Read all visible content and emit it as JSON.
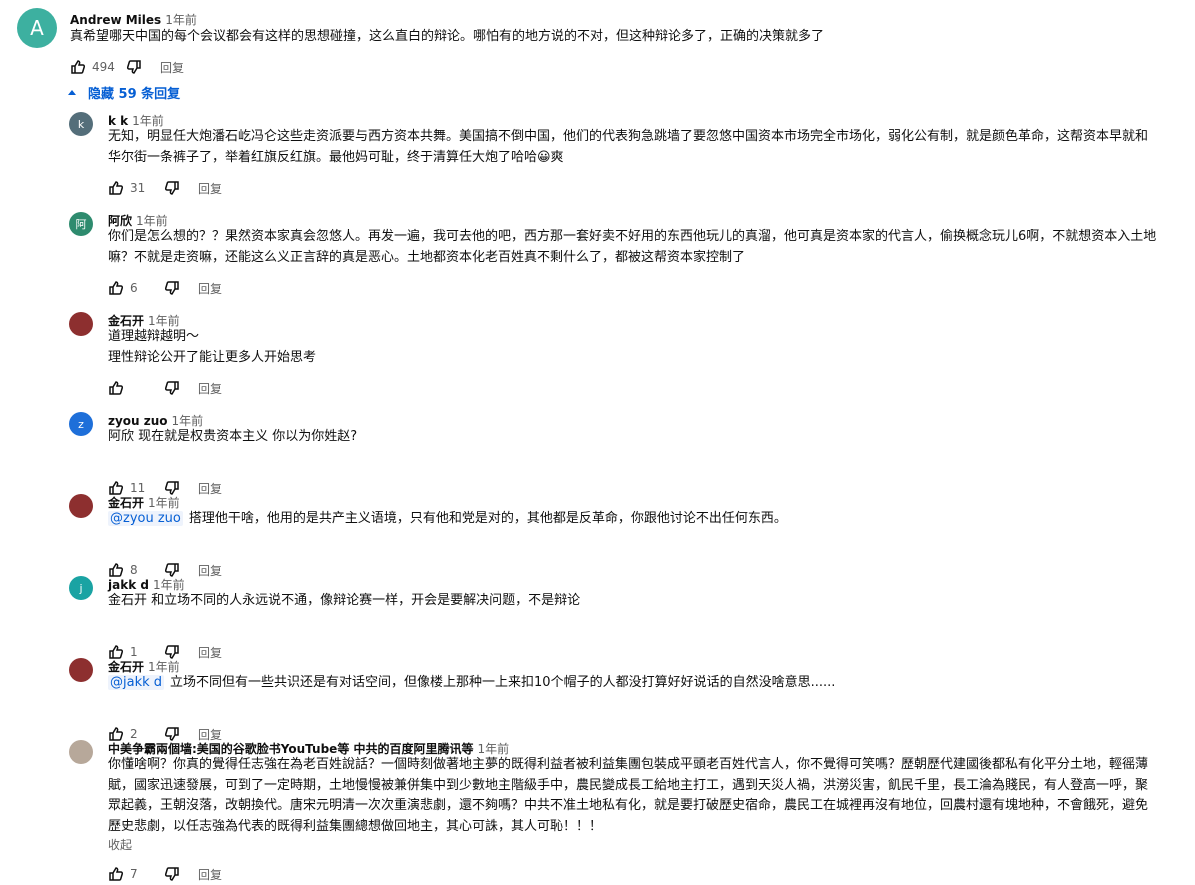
{
  "top_comment": {
    "avatar_letter": "A",
    "avatar_color": "#3db0a0",
    "author": "Andrew Miles",
    "time": "1年前",
    "text": "真希望哪天中国的每个会议都会有这样的思想碰撞，这么直白的辩论。哪怕有的地方说的不对，但这种辩论多了，正确的决策就多了",
    "likes": "494",
    "reply_label": "回复"
  },
  "hide_replies_label": "隐藏 59 条回复",
  "replies": [
    {
      "avatar_letter": "k",
      "avatar_color": "#546e7a",
      "author": "k k",
      "time": "1年前",
      "lines": [
        "无知，明显任大炮潘石屹冯仑这些走资派要与西方资本共舞。美国搞不倒中国，他们的代表狗急跳墙了要忽悠中国资本市场完全市场化，弱化公有制，就是颜色革命，这帮资本早就和",
        "华尔街一条裤子了，举着红旗反红旗。最他妈可耻，终于清算任大炮了哈哈😀爽"
      ],
      "likes": "31",
      "reply_label": "回复"
    },
    {
      "avatar_letter": "阿",
      "avatar_color": "#2e8b6e",
      "author": "阿欣",
      "time": "1年前",
      "lines": [
        "你们是怎么想的？？果然资本家真会忽悠人。再发一遍，我可去他的吧，西方那一套好卖不好用的东西他玩儿的真溜，他可真是资本家的代言人，偷换概念玩儿6啊，不就想资本入土地",
        "嘛？不就是走资嘛，还能这么义正言辞的真是恶心。土地都资本化老百姓真不剩什么了，都被这帮资本家控制了"
      ],
      "likes": "6",
      "reply_label": "回复"
    },
    {
      "avatar_letter": "",
      "avatar_color": "#8d2f2f",
      "author": "金石开",
      "time": "1年前",
      "lines": [
        "道理越辩越明～",
        "理性辩论公开了能让更多人开始思考"
      ],
      "likes": "",
      "reply_label": "回复"
    },
    {
      "avatar_letter": "z",
      "avatar_color": "#1e6fd9",
      "author": "zyou zuo",
      "time": "1年前",
      "lines": [
        "阿欣 现在就是权贵资本主义 你以为你姓赵?"
      ],
      "likes": "11",
      "reply_label": "回复"
    },
    {
      "avatar_letter": "",
      "avatar_color": "#8d2f2f",
      "author": "金石开",
      "time": "1年前",
      "mention": "@zyou zuo",
      "lines": [
        "搭理他干啥，他用的是共产主义语境，只有他和党是对的，其他都是反革命，你跟他讨论不出任何东西。"
      ],
      "likes": "8",
      "reply_label": "回复"
    },
    {
      "avatar_letter": "j",
      "avatar_color": "#1aa3a3",
      "author": "jakk d",
      "time": "1年前",
      "lines": [
        "金石开 和立场不同的人永远说不通，像辩论赛一样，开会是要解决问题，不是辩论"
      ],
      "likes": "1",
      "reply_label": "回复"
    },
    {
      "avatar_letter": "",
      "avatar_color": "#8d2f2f",
      "author": "金石开",
      "time": "1年前",
      "mention": "@jakk d",
      "lines": [
        "立场不同但有一些共识还是有对话空间，但像楼上那种一上来扣10个帽子的人都没打算好好说话的自然没啥意思......"
      ],
      "likes": "2",
      "reply_label": "回复"
    },
    {
      "avatar_letter": "",
      "avatar_color": "#b7a89a",
      "author": "中美争霸兩個墙:美国的谷歌脸书YouTube等 中共的百度阿里腾讯等",
      "time": "1年前",
      "lines": [
        "你懂啥啊？你真的覺得任志強在為老百姓說話？一個時刻做著地主夢的既得利益者被利益集團包裝成平頭老百姓代言人，你不覺得可笑嗎？歷朝歷代建國後都私有化平分土地，輕徭薄",
        "賦，國家迅速發展，可到了一定時期，土地慢慢被兼併集中到少數地主階級手中，農民變成長工給地主打工，遇到天災人禍，洪澇災害，飢民千里，長工淪為賤民，有人登高一呼，聚",
        "眾起義，王朝沒落，改朝換代。唐宋元明清一次次重演悲劇，還不夠嗎？中共不准土地私有化，就是要打破歷史宿命，農民工在城裡再沒有地位，回農村還有塊地种，不會餓死，避免",
        "歷史悲劇，以任志強為代表的既得利益集團總想做回地主，其心可誅，其人可恥！！！"
      ],
      "collapse_label": "收起",
      "likes": "7",
      "reply_label": "回复"
    }
  ]
}
